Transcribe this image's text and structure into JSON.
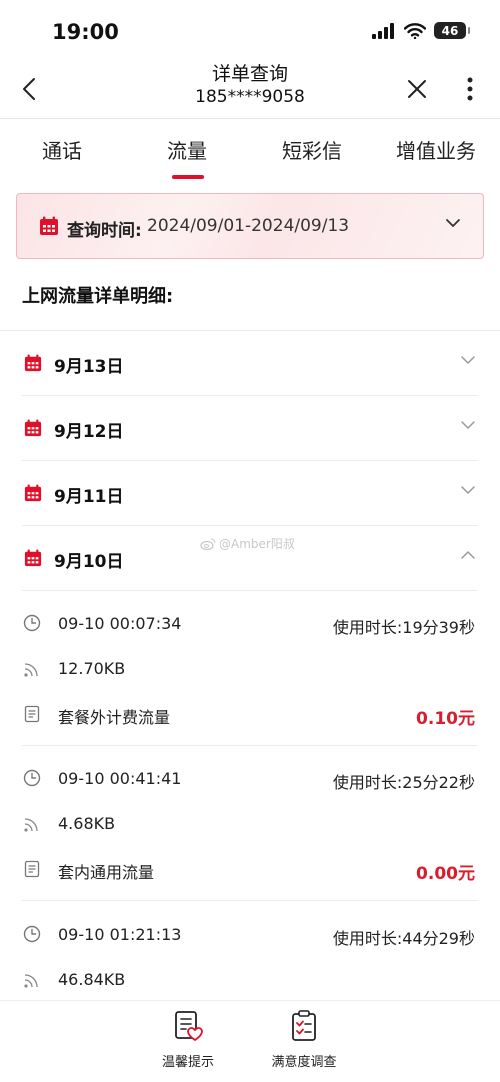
{
  "status_bar": {
    "time": "19:00",
    "battery": "46"
  },
  "nav": {
    "title": "详单查询",
    "phone": "185****9058"
  },
  "tabs": [
    {
      "label": "通话"
    },
    {
      "label": "流量"
    },
    {
      "label": "短彩信"
    },
    {
      "label": "增值业务"
    }
  ],
  "active_tab": "流量",
  "query": {
    "label": "查询时间:",
    "range": "2024/09/01-2024/09/13"
  },
  "section_title": "上网流量详单明细:",
  "days": [
    {
      "label": "9月13日",
      "expanded": false
    },
    {
      "label": "9月12日",
      "expanded": false
    },
    {
      "label": "9月11日",
      "expanded": false
    },
    {
      "label": "9月10日",
      "expanded": true
    }
  ],
  "records": [
    {
      "time": "09-10 00:07:34",
      "duration_label": "使用时长:",
      "duration": "19分39秒",
      "volume": "12.70KB",
      "type": "套餐外计费流量",
      "fee": "0.10元"
    },
    {
      "time": "09-10 00:41:41",
      "duration_label": "使用时长:",
      "duration": "25分22秒",
      "volume": "4.68KB",
      "type": "套内通用流量",
      "fee": "0.00元"
    },
    {
      "time": "09-10 01:21:13",
      "duration_label": "使用时长:",
      "duration": "44分29秒",
      "volume": "46.84KB"
    }
  ],
  "watermark": "@Amber阳叔",
  "bottom_bar": {
    "tips": "温馨提示",
    "survey": "满意度调查"
  },
  "colors": {
    "accent": "#e0102a",
    "fee": "#d81e2d",
    "query_bg": "#fbe4e6"
  }
}
